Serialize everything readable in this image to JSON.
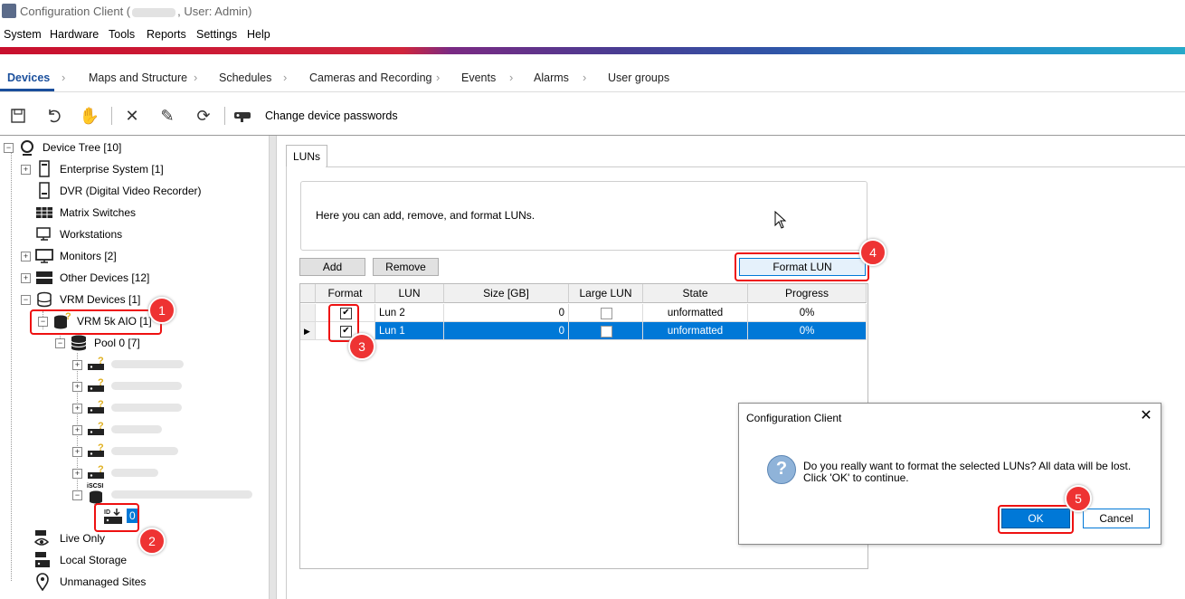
{
  "window": {
    "title_prefix": "Configuration Client (",
    "title_suffix": ", User: Admin)"
  },
  "menu": [
    "System",
    "Hardware",
    "Tools",
    "Reports",
    "Settings",
    "Help"
  ],
  "nav": [
    "Devices",
    "Maps and Structure",
    "Schedules",
    "Cameras and Recording",
    "Events",
    "Alarms",
    "User groups"
  ],
  "toolbar": {
    "icons": [
      "save-icon",
      "undo-icon",
      "hand-icon",
      "delete-icon",
      "edit-icon",
      "refresh-icon",
      "password-key-icon"
    ],
    "change_passwords": "Change device passwords"
  },
  "tree": {
    "root": "Device Tree [10]",
    "enterprise": "Enterprise System [1]",
    "dvr": "DVR (Digital Video Recorder)",
    "matrix": "Matrix Switches",
    "workstations": "Workstations",
    "monitors": "Monitors [2]",
    "other": "Other Devices [12]",
    "vrm_devices": "VRM Devices [1]",
    "vrm_5k": "VRM 5k AIO [1]",
    "pool": "Pool 0 [7]",
    "iscsi_label": "iSCSI",
    "lun_node": "0",
    "live_only": "Live Only",
    "local_storage": "Local Storage",
    "unmanaged": "Unmanaged Sites"
  },
  "panel": {
    "tab": "LUNs",
    "info": "Here you can add, remove, and format LUNs.",
    "add": "Add",
    "remove": "Remove",
    "format_lun": "Format LUN"
  },
  "grid": {
    "columns": [
      "Format",
      "LUN",
      "Size [GB]",
      "Large LUN",
      "State",
      "Progress"
    ],
    "rows": [
      {
        "format": true,
        "lun": "Lun 2",
        "size": "0",
        "large": false,
        "state": "unformatted",
        "progress": "0%",
        "selected": false
      },
      {
        "format": true,
        "lun": "Lun 1",
        "size": "0",
        "large": false,
        "state": "unformatted",
        "progress": "0%",
        "selected": true
      }
    ]
  },
  "dialog": {
    "title": "Configuration Client",
    "message": "Do you really want to format the selected LUNs? All data will be lost. Click 'OK' to continue.",
    "ok": "OK",
    "cancel": "Cancel"
  },
  "callouts": [
    "1",
    "2",
    "3",
    "4",
    "5"
  ],
  "colors": {
    "accent": "#0078d7",
    "nav_active": "#1a4f9c",
    "callout": "#e33333"
  }
}
